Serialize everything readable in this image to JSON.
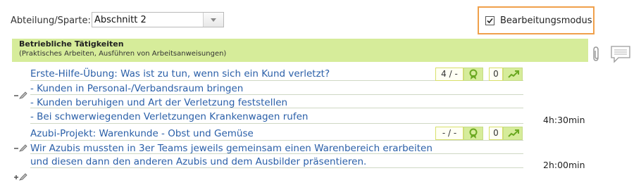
{
  "header": {
    "department_label": "Abteilung/Sparte:",
    "department_value": "Abschnitt 2",
    "edit_mode_label": "Bearbeitungsmodus",
    "edit_mode_checked": true
  },
  "section": {
    "title": "Betriebliche Tätigkeiten",
    "subtitle": "(Praktisches Arbeiten, Ausführen von Arbeitsanweisungen)",
    "bar_color": "#d6ec9a"
  },
  "entries": [
    {
      "lines": [
        "Erste-Hilfe-Übung: Was ist zu tun, wenn sich ein Kund verletzt?",
        "- Kunden in Personal-/Verbandsraum bringen",
        "- Kunden beruhigen und Art der Verletzung feststellen",
        "- Bei schwerwiegenden Verletzungen Krankenwagen rufen"
      ],
      "rating": "4 / -",
      "count": "0",
      "duration": "4h:30min"
    },
    {
      "lines": [
        "Azubi-Projekt: Warenkunde -  Obst und Gemüse",
        "Wir Azubis mussten in 3er Teams jeweils gemeinsam einen Warenbereich erarbeiten",
        "und diesen dann den anderen Azubis und dem Ausbilder präsentieren."
      ],
      "rating": "- / -",
      "count": "0",
      "duration": "2h:00min"
    }
  ],
  "colors": {
    "accent_orange": "#f0a04b",
    "link_blue": "#2a5fa8",
    "green": "#6aa820"
  }
}
